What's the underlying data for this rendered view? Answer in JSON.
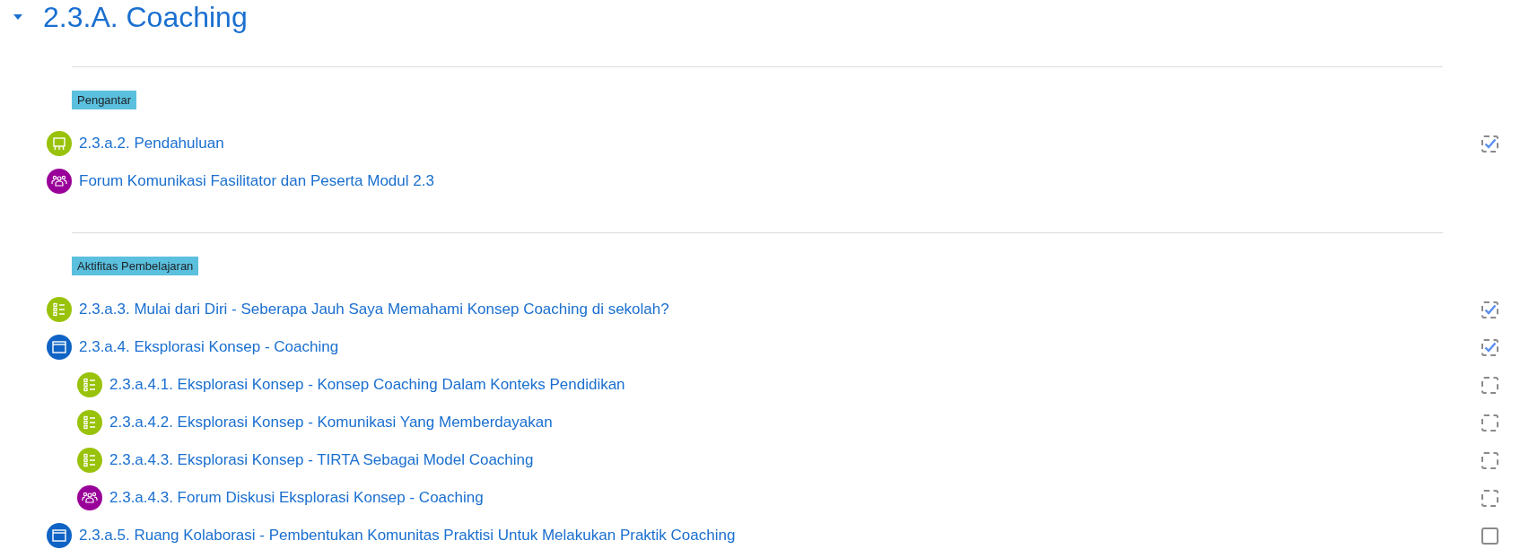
{
  "section": {
    "title": "2.3.A. Coaching",
    "expanded": true
  },
  "groups": [
    {
      "label": "Pengantar",
      "items": [
        {
          "kind": "presentation",
          "title": "2.3.a.2. Pendahuluan",
          "auto_completion": true,
          "checked": true
        },
        {
          "kind": "forum",
          "title": "Forum Komunikasi Fasilitator dan Peserta Modul 2.3"
        }
      ]
    },
    {
      "label": "Aktifitas Pembelajaran",
      "items": [
        {
          "kind": "checklist",
          "title": "2.3.a.3. Mulai dari Diri - Seberapa Jauh Saya Memahami Konsep Coaching di sekolah?",
          "auto_completion": true,
          "checked": true
        },
        {
          "kind": "page",
          "title": "2.3.a.4. Eksplorasi Konsep - Coaching",
          "auto_completion": true,
          "checked": true,
          "children": [
            {
              "kind": "checklist",
              "title": "2.3.a.4.1. Eksplorasi Konsep - Konsep Coaching Dalam Konteks Pendidikan",
              "auto_completion": true,
              "checked": false
            },
            {
              "kind": "checklist",
              "title": "2.3.a.4.2. Eksplorasi Konsep - Komunikasi Yang Memberdayakan",
              "auto_completion": true,
              "checked": false
            },
            {
              "kind": "checklist",
              "title": "2.3.a.4.3. Eksplorasi Konsep - TIRTA Sebagai Model Coaching",
              "auto_completion": true,
              "checked": false
            },
            {
              "kind": "forum",
              "title": "2.3.a.4.3. Forum Diskusi Eksplorasi Konsep - Coaching",
              "auto_completion": true,
              "checked": false
            }
          ]
        },
        {
          "kind": "page",
          "title": "2.3.a.5. Ruang Kolaborasi - Pembentukan Komunitas Praktisi Untuk Melakukan Praktik Coaching",
          "auto_completion": false,
          "checked": false
        }
      ]
    }
  ]
}
